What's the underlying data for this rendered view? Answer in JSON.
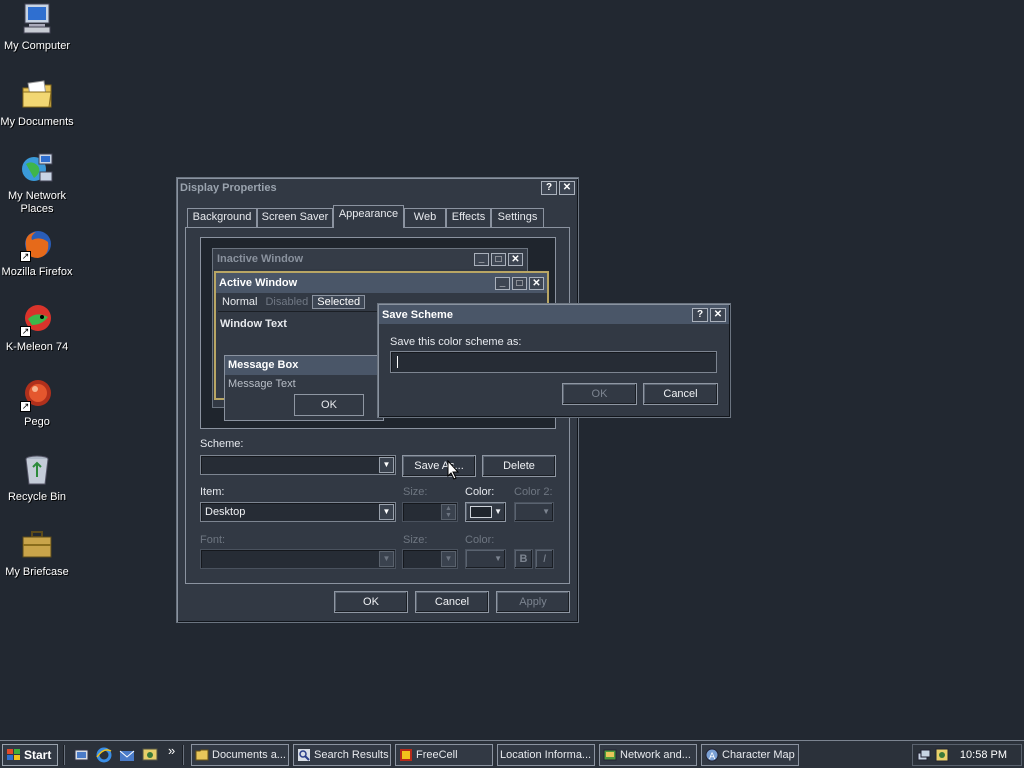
{
  "desktop": {
    "icons": [
      {
        "label": "My Computer",
        "icon": "computer-icon"
      },
      {
        "label": "My Documents",
        "icon": "folder-documents-icon"
      },
      {
        "label": "My Network Places",
        "icon": "network-icon"
      },
      {
        "label": "Mozilla Firefox",
        "icon": "firefox-icon"
      },
      {
        "label": "K-Meleon 74",
        "icon": "kmeleon-icon"
      },
      {
        "label": "Pego",
        "icon": "pego-icon"
      },
      {
        "label": "Recycle Bin",
        "icon": "recycle-bin-icon"
      },
      {
        "label": "My Briefcase",
        "icon": "briefcase-icon"
      }
    ]
  },
  "display_properties": {
    "title": "Display Properties",
    "help_btn": "?",
    "close_btn": "✕",
    "tabs": [
      "Background",
      "Screen Saver",
      "Appearance",
      "Web",
      "Effects",
      "Settings"
    ],
    "active_tab": "Appearance",
    "preview": {
      "inactive_title": "Inactive Window",
      "active_title": "Active Window",
      "menu_normal": "Normal",
      "menu_disabled": "Disabled",
      "menu_selected": "Selected",
      "window_text": "Window Text",
      "msgbox_title": "Message Box",
      "msgbox_text": "Message Text",
      "msgbox_ok": "OK"
    },
    "scheme_label": "Scheme:",
    "scheme_value": "",
    "save_as": "Save As...",
    "delete": "Delete",
    "item_label": "Item:",
    "item_value": "Desktop",
    "size_label": "Size:",
    "color_label": "Color:",
    "color2_label": "Color 2:",
    "font_label": "Font:",
    "font_size_label": "Size:",
    "font_color_label": "Color:",
    "bold": "B",
    "italic": "I",
    "ok": "OK",
    "cancel": "Cancel",
    "apply": "Apply",
    "colors": {
      "desktop_swatch": "#1f252d"
    }
  },
  "save_scheme": {
    "title": "Save Scheme",
    "help_btn": "?",
    "close_btn": "✕",
    "prompt": "Save this color scheme as:",
    "input_value": "",
    "ok": "OK",
    "cancel": "Cancel"
  },
  "taskbar": {
    "start": "Start",
    "quick_launch": [
      "show-desktop-icon",
      "ie-icon",
      "outlook-icon",
      "media-icon"
    ],
    "chevron": "»",
    "tasks": [
      {
        "label": "Documents a...",
        "icon": "folder-icon"
      },
      {
        "label": "Search Results",
        "icon": "search-icon"
      },
      {
        "label": "FreeCell",
        "icon": "freecell-icon"
      },
      {
        "label": "Location Informa...",
        "icon": ""
      },
      {
        "label": "Network and...",
        "icon": "network-folder-icon"
      },
      {
        "label": "Character Map",
        "icon": "character-map-icon"
      }
    ],
    "clock": "10:58 PM"
  }
}
